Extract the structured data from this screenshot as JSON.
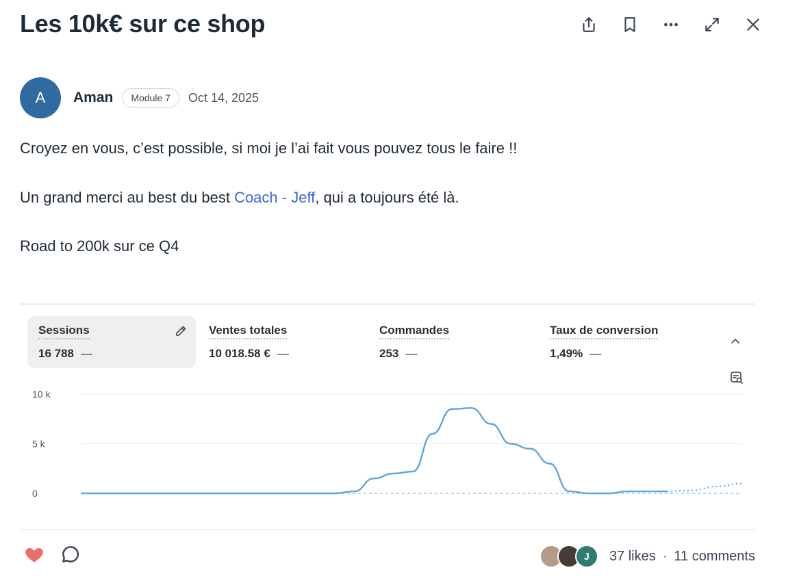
{
  "post": {
    "title": "Les 10k€ sur ce shop",
    "author": {
      "initial": "A",
      "name": "Aman",
      "badge": "Module 7",
      "date": "Oct 14, 2025"
    },
    "body": {
      "line1": "Croyez en vous, c’est possible, si moi je l’ai fait vous pouvez tous le faire !!",
      "line2_before": "Un grand merci au best du best ",
      "line2_mention": "Coach - Jeff",
      "line2_after": ", qui a toujours été là.",
      "line3": "Road to 200k sur ce Q4"
    }
  },
  "header_icons": [
    "share-icon",
    "bookmark-icon",
    "more-icon",
    "expand-icon",
    "close-icon"
  ],
  "metrics": [
    {
      "label": "Sessions",
      "value": "16 788",
      "trend": "—"
    },
    {
      "label": "Ventes totales",
      "value": "10 018.58 €",
      "trend": "—"
    },
    {
      "label": "Commandes",
      "value": "253",
      "trend": "—"
    },
    {
      "label": "Taux de conversion",
      "value": "1,49%",
      "trend": "—"
    }
  ],
  "chart_data": {
    "type": "line",
    "y_ticks": [
      "10 k",
      "5 k",
      "0"
    ],
    "ylim": [
      0,
      10000
    ],
    "series": [
      {
        "values": [
          0,
          0,
          0,
          0,
          0,
          0,
          0,
          0,
          0,
          0,
          0,
          0,
          0,
          0,
          200,
          1500,
          2000,
          2200,
          6000,
          8500,
          8600,
          7000,
          5000,
          4500,
          3000,
          200,
          0,
          0,
          200,
          200,
          200
        ]
      },
      {
        "values": [
          200,
          300,
          700,
          1000
        ]
      }
    ],
    "colors": {
      "line": "#5fa3e0",
      "baseline": "#8bb9e6",
      "grid": "#e8eaed"
    }
  },
  "footer": {
    "likes": "37 likes",
    "separator": "·",
    "comments": "11 comments",
    "likers": [
      {
        "initial": "",
        "color": "#b69a88"
      },
      {
        "initial": "",
        "color": "#4a3a36"
      },
      {
        "initial": "J",
        "color": "#2f7c73"
      }
    ],
    "heart_color": "#e8706a"
  }
}
